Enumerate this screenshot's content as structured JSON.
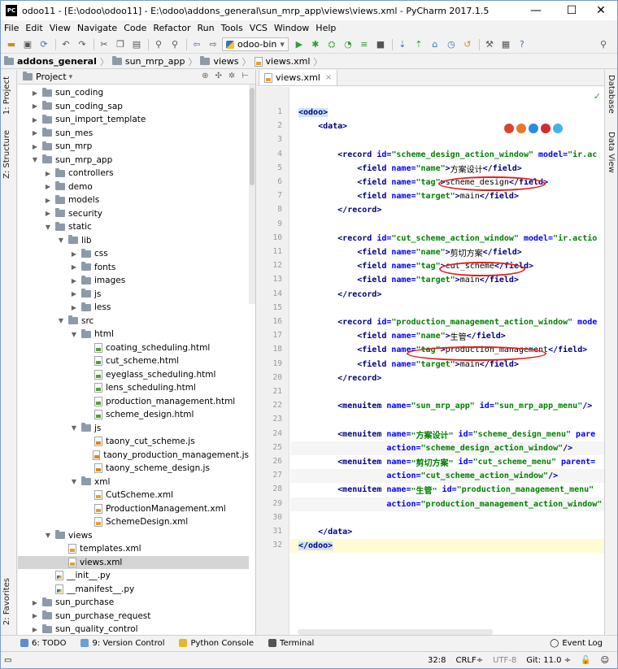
{
  "window": {
    "title": "odoo11 - [E:\\odoo\\odoo11] - E:\\odoo\\addons_general\\sun_mrp_app\\views\\views.xml - PyCharm 2017.1.5",
    "logo_text": "PC",
    "minimize": "—",
    "maximize": "☐",
    "close": "✕"
  },
  "menu": [
    "File",
    "Edit",
    "View",
    "Navigate",
    "Code",
    "Refactor",
    "Run",
    "Tools",
    "VCS",
    "Window",
    "Help"
  ],
  "toolbar": {
    "run_config": "odoo-bin",
    "run_config_arrow": "▾"
  },
  "breadcrumb": [
    {
      "label": "addons_general",
      "icon": "folder-icon",
      "bold": true
    },
    {
      "label": "sun_mrp_app",
      "icon": "folder-icon"
    },
    {
      "label": "views",
      "icon": "folder-icon"
    },
    {
      "label": "views.xml",
      "icon": "xml-file-icon"
    }
  ],
  "left_strip": {
    "project": "1: Project",
    "structure": "Z: Structure",
    "favorites": "2: Favorites"
  },
  "right_strip": {
    "database": "Database",
    "dataview": "Data View"
  },
  "project_panel": {
    "title": "Project",
    "title_arrow": "▾",
    "tree": [
      {
        "label": "sun_coding",
        "depth": 0,
        "type": "folder",
        "arrow": "▶"
      },
      {
        "label": "sun_coding_sap",
        "depth": 0,
        "type": "folder",
        "arrow": "▶"
      },
      {
        "label": "sun_import_template",
        "depth": 0,
        "type": "folder",
        "arrow": "▶"
      },
      {
        "label": "sun_mes",
        "depth": 0,
        "type": "folder",
        "arrow": "▶"
      },
      {
        "label": "sun_mrp",
        "depth": 0,
        "type": "folder",
        "arrow": "▶"
      },
      {
        "label": "sun_mrp_app",
        "depth": 0,
        "type": "folder",
        "arrow": "▼"
      },
      {
        "label": "controllers",
        "depth": 1,
        "type": "folder",
        "arrow": "▶"
      },
      {
        "label": "demo",
        "depth": 1,
        "type": "folder",
        "arrow": "▶"
      },
      {
        "label": "models",
        "depth": 1,
        "type": "folder",
        "arrow": "▶"
      },
      {
        "label": "security",
        "depth": 1,
        "type": "folder",
        "arrow": "▶"
      },
      {
        "label": "static",
        "depth": 1,
        "type": "folder",
        "arrow": "▼"
      },
      {
        "label": "lib",
        "depth": 2,
        "type": "folder",
        "arrow": "▼"
      },
      {
        "label": "css",
        "depth": 3,
        "type": "folder",
        "arrow": "▶"
      },
      {
        "label": "fonts",
        "depth": 3,
        "type": "folder",
        "arrow": "▶"
      },
      {
        "label": "images",
        "depth": 3,
        "type": "folder",
        "arrow": "▶"
      },
      {
        "label": "js",
        "depth": 3,
        "type": "folder",
        "arrow": "▶"
      },
      {
        "label": "less",
        "depth": 3,
        "type": "folder",
        "arrow": "▶"
      },
      {
        "label": "src",
        "depth": 2,
        "type": "folder",
        "arrow": "▼"
      },
      {
        "label": "html",
        "depth": 3,
        "type": "folder",
        "arrow": "▼"
      },
      {
        "label": "coating_scheduling.html",
        "depth": 4,
        "type": "html",
        "arrow": ""
      },
      {
        "label": "cut_scheme.html",
        "depth": 4,
        "type": "html",
        "arrow": ""
      },
      {
        "label": "eyeglass_scheduling.html",
        "depth": 4,
        "type": "html",
        "arrow": ""
      },
      {
        "label": "lens_scheduling.html",
        "depth": 4,
        "type": "html",
        "arrow": ""
      },
      {
        "label": "production_management.html",
        "depth": 4,
        "type": "html",
        "arrow": ""
      },
      {
        "label": "scheme_design.html",
        "depth": 4,
        "type": "html",
        "arrow": ""
      },
      {
        "label": "js",
        "depth": 3,
        "type": "folder",
        "arrow": "▼"
      },
      {
        "label": "taony_cut_scheme.js",
        "depth": 4,
        "type": "js",
        "arrow": ""
      },
      {
        "label": "taony_production_management.js",
        "depth": 4,
        "type": "js",
        "arrow": ""
      },
      {
        "label": "taony_scheme_design.js",
        "depth": 4,
        "type": "js",
        "arrow": ""
      },
      {
        "label": "xml",
        "depth": 3,
        "type": "folder",
        "arrow": "▼"
      },
      {
        "label": "CutScheme.xml",
        "depth": 4,
        "type": "xml",
        "arrow": ""
      },
      {
        "label": "ProductionManagement.xml",
        "depth": 4,
        "type": "xml",
        "arrow": ""
      },
      {
        "label": "SchemeDesign.xml",
        "depth": 4,
        "type": "xml",
        "arrow": ""
      },
      {
        "label": "views",
        "depth": 1,
        "type": "folder",
        "arrow": "▼"
      },
      {
        "label": "templates.xml",
        "depth": 2,
        "type": "xml",
        "arrow": ""
      },
      {
        "label": "views.xml",
        "depth": 2,
        "type": "xml",
        "arrow": "",
        "selected": true
      },
      {
        "label": "__init__.py",
        "depth": 1,
        "type": "py",
        "arrow": ""
      },
      {
        "label": "__manifest__.py",
        "depth": 1,
        "type": "py",
        "arrow": ""
      },
      {
        "label": "sun_purchase",
        "depth": 0,
        "type": "folder",
        "arrow": "▶"
      },
      {
        "label": "sun_purchase_request",
        "depth": 0,
        "type": "folder",
        "arrow": "▶"
      },
      {
        "label": "sun_quality_control",
        "depth": 0,
        "type": "folder",
        "arrow": "▶"
      }
    ]
  },
  "editor": {
    "tab_label": "views.xml",
    "tab_close": "×",
    "check": "✓",
    "current_line": 32,
    "lines": [
      {
        "n": 1,
        "parts": [
          {
            "c": "tagcur",
            "t": "<odoo>"
          }
        ]
      },
      {
        "n": 2,
        "parts": [
          {
            "c": "",
            "t": "    <data>"
          }
        ]
      },
      {
        "n": 3,
        "parts": []
      },
      {
        "n": 4,
        "parts": [
          {
            "c": "",
            "t": "        <record "
          },
          {
            "c": "att",
            "t": "id="
          },
          {
            "c": "val",
            "t": "\"scheme_design_action_window\" "
          },
          {
            "c": "att",
            "t": "model="
          },
          {
            "c": "val",
            "t": "\"ir.ac"
          }
        ]
      },
      {
        "n": 5,
        "parts": [
          {
            "c": "",
            "t": "            <field "
          },
          {
            "c": "att",
            "t": "name="
          },
          {
            "c": "val",
            "t": "\"name\""
          },
          {
            "c": "",
            "t": ">"
          },
          {
            "c": "txt",
            "t": "方案设计"
          },
          {
            "c": "",
            "t": "</field>"
          }
        ]
      },
      {
        "n": 6,
        "parts": [
          {
            "c": "",
            "t": "            <field "
          },
          {
            "c": "att",
            "t": "name="
          },
          {
            "c": "val",
            "t": "\"tag\""
          },
          {
            "c": "",
            "t": ">"
          },
          {
            "c": "txt",
            "t": "scheme_design"
          },
          {
            "c": "",
            "t": "</field>"
          }
        ]
      },
      {
        "n": 7,
        "parts": [
          {
            "c": "",
            "t": "            <field "
          },
          {
            "c": "att",
            "t": "name="
          },
          {
            "c": "val",
            "t": "\"target\""
          },
          {
            "c": "",
            "t": ">"
          },
          {
            "c": "txt",
            "t": "main"
          },
          {
            "c": "",
            "t": "</field>"
          }
        ]
      },
      {
        "n": 8,
        "parts": [
          {
            "c": "",
            "t": "        </record>"
          }
        ]
      },
      {
        "n": 9,
        "parts": []
      },
      {
        "n": 10,
        "parts": [
          {
            "c": "",
            "t": "        <record "
          },
          {
            "c": "att",
            "t": "id="
          },
          {
            "c": "val",
            "t": "\"cut_scheme_action_window\" "
          },
          {
            "c": "att",
            "t": "model="
          },
          {
            "c": "val",
            "t": "\"ir.actio"
          }
        ]
      },
      {
        "n": 11,
        "parts": [
          {
            "c": "",
            "t": "            <field "
          },
          {
            "c": "att",
            "t": "name="
          },
          {
            "c": "val",
            "t": "\"name\""
          },
          {
            "c": "",
            "t": ">"
          },
          {
            "c": "txt",
            "t": "剪切方案"
          },
          {
            "c": "",
            "t": "</field>"
          }
        ]
      },
      {
        "n": 12,
        "parts": [
          {
            "c": "",
            "t": "            <field "
          },
          {
            "c": "att",
            "t": "name="
          },
          {
            "c": "val",
            "t": "\"tag\""
          },
          {
            "c": "",
            "t": ">"
          },
          {
            "c": "txt",
            "t": "cut_scheme"
          },
          {
            "c": "",
            "t": "</field>"
          }
        ]
      },
      {
        "n": 13,
        "parts": [
          {
            "c": "",
            "t": "            <field "
          },
          {
            "c": "att",
            "t": "name="
          },
          {
            "c": "val",
            "t": "\"target\""
          },
          {
            "c": "",
            "t": ">"
          },
          {
            "c": "txt",
            "t": "main"
          },
          {
            "c": "",
            "t": "</field>"
          }
        ]
      },
      {
        "n": 14,
        "parts": [
          {
            "c": "",
            "t": "        </record>"
          }
        ]
      },
      {
        "n": 15,
        "parts": []
      },
      {
        "n": 16,
        "parts": [
          {
            "c": "",
            "t": "        <record "
          },
          {
            "c": "att",
            "t": "id="
          },
          {
            "c": "val",
            "t": "\"production_management_action_window\" "
          },
          {
            "c": "att",
            "t": "mode"
          }
        ]
      },
      {
        "n": 17,
        "parts": [
          {
            "c": "",
            "t": "            <field "
          },
          {
            "c": "att",
            "t": "name="
          },
          {
            "c": "val",
            "t": "\"name\""
          },
          {
            "c": "",
            "t": ">"
          },
          {
            "c": "txt",
            "t": "生管"
          },
          {
            "c": "",
            "t": "</field>"
          }
        ]
      },
      {
        "n": 18,
        "parts": [
          {
            "c": "",
            "t": "            <field "
          },
          {
            "c": "att",
            "t": "name="
          },
          {
            "c": "val",
            "t": "\"tag\""
          },
          {
            "c": "",
            "t": ">"
          },
          {
            "c": "txt",
            "t": "production_management"
          },
          {
            "c": "",
            "t": "</field>"
          }
        ]
      },
      {
        "n": 19,
        "parts": [
          {
            "c": "",
            "t": "            <field "
          },
          {
            "c": "att",
            "t": "name="
          },
          {
            "c": "val",
            "t": "\"target\""
          },
          {
            "c": "",
            "t": ">"
          },
          {
            "c": "txt",
            "t": "main"
          },
          {
            "c": "",
            "t": "</field>"
          }
        ]
      },
      {
        "n": 20,
        "parts": [
          {
            "c": "",
            "t": "        </record>"
          }
        ]
      },
      {
        "n": 21,
        "parts": []
      },
      {
        "n": 22,
        "parts": [
          {
            "c": "",
            "t": "        <menuitem "
          },
          {
            "c": "att",
            "t": "name="
          },
          {
            "c": "val",
            "t": "\"sun_mrp_app\" "
          },
          {
            "c": "att",
            "t": "id="
          },
          {
            "c": "val",
            "t": "\"sun_mrp_app_menu\""
          },
          {
            "c": "",
            "t": "/>"
          }
        ]
      },
      {
        "n": 23,
        "parts": []
      },
      {
        "n": 24,
        "parts": [
          {
            "c": "",
            "t": "        <menuitem "
          },
          {
            "c": "att",
            "t": "name="
          },
          {
            "c": "val",
            "t": "\"方案设计\" "
          },
          {
            "c": "att",
            "t": "id="
          },
          {
            "c": "val",
            "t": "\"scheme_design_menu\" "
          },
          {
            "c": "att",
            "t": "pare"
          }
        ]
      },
      {
        "n": 25,
        "parts": [
          {
            "c": "",
            "t": "                  "
          },
          {
            "c": "att",
            "t": "action="
          },
          {
            "c": "val",
            "t": "\"scheme_design_action_window\""
          },
          {
            "c": "",
            "t": "/>"
          }
        ]
      },
      {
        "n": 26,
        "parts": [
          {
            "c": "",
            "t": "        <menuitem "
          },
          {
            "c": "att",
            "t": "name="
          },
          {
            "c": "val",
            "t": "\"剪切方案\" "
          },
          {
            "c": "att",
            "t": "id="
          },
          {
            "c": "val",
            "t": "\"cut_scheme_menu\" "
          },
          {
            "c": "att",
            "t": "parent="
          }
        ]
      },
      {
        "n": 27,
        "parts": [
          {
            "c": "",
            "t": "                  "
          },
          {
            "c": "att",
            "t": "action="
          },
          {
            "c": "val",
            "t": "\"cut_scheme_action_window\""
          },
          {
            "c": "",
            "t": "/>"
          }
        ]
      },
      {
        "n": 28,
        "parts": [
          {
            "c": "",
            "t": "        <menuitem "
          },
          {
            "c": "att",
            "t": "name="
          },
          {
            "c": "val",
            "t": "\"生管\" "
          },
          {
            "c": "att",
            "t": "id="
          },
          {
            "c": "val",
            "t": "\"production_management_menu\""
          }
        ]
      },
      {
        "n": 29,
        "parts": [
          {
            "c": "",
            "t": "                  "
          },
          {
            "c": "att",
            "t": "action="
          },
          {
            "c": "val",
            "t": "\"production_management_action_window\""
          }
        ]
      },
      {
        "n": 30,
        "parts": []
      },
      {
        "n": 31,
        "parts": [
          {
            "c": "",
            "t": "    </data>"
          }
        ]
      },
      {
        "n": 32,
        "parts": [
          {
            "c": "tagcur",
            "t": "</odoo>"
          }
        ]
      }
    ]
  },
  "bottom_tools": [
    {
      "label": "6: TODO",
      "icon": "todo-icon",
      "color": "#5a8fd0"
    },
    {
      "label": "9: Version Control",
      "icon": "vcs-icon",
      "color": "#6a9fd8"
    },
    {
      "label": "Python Console",
      "icon": "python-console-icon",
      "color": "#e3b62b"
    },
    {
      "label": "Terminal",
      "icon": "terminal-icon",
      "color": "#555555"
    }
  ],
  "event_log": "Event Log",
  "status": {
    "position": "32:8",
    "line_sep": "CRLF÷",
    "encoding": "UTF-8",
    "git": "Git: 11.0 ÷"
  },
  "colors": {
    "annotation": "#e02020",
    "browser_icons": [
      "#d9442c",
      "#e8792a",
      "#2a8be0",
      "#d42b2b",
      "#45b3e6"
    ]
  }
}
